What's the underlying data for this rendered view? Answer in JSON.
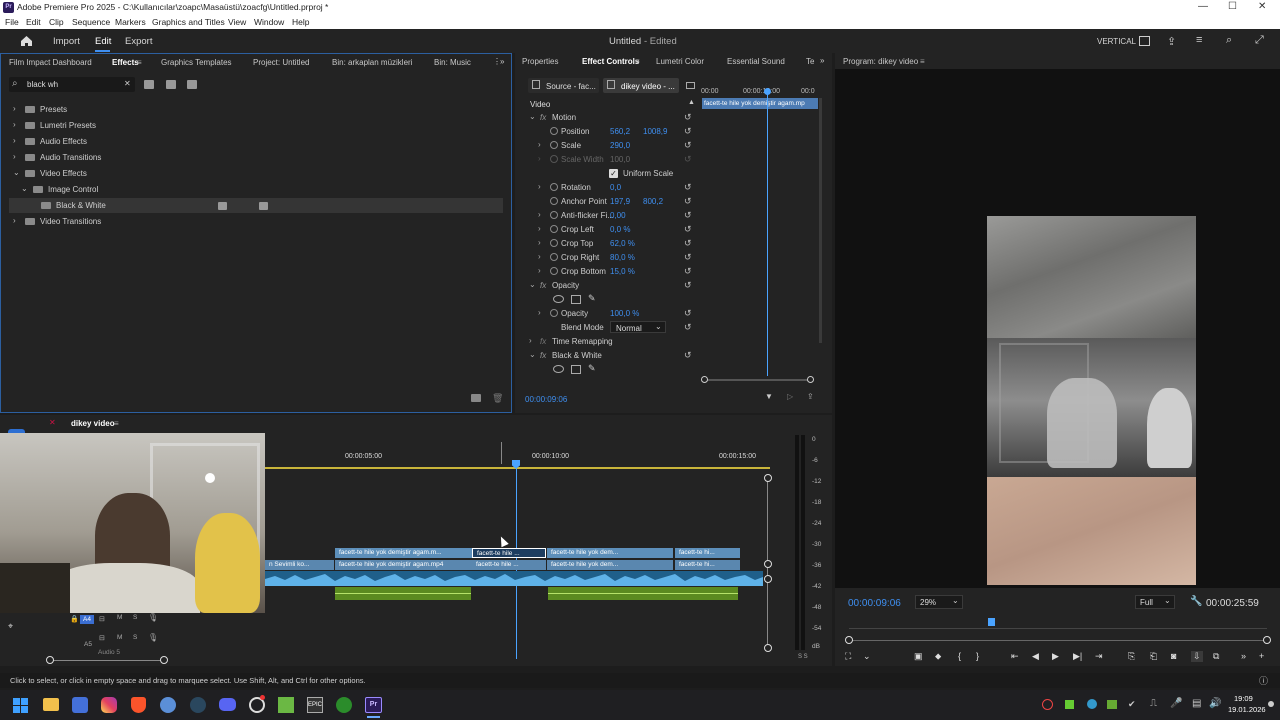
{
  "titlebar": {
    "icon": "Pr",
    "title": "Adobe Premiere Pro 2025 - C:\\Kullanıcılar\\zoapc\\Masaüstü\\zoacfg\\Untitled.prproj *",
    "minimize": "—",
    "maximize": "☐",
    "close": "✕"
  },
  "menu": [
    "File",
    "Edit",
    "Clip",
    "Sequence",
    "Markers",
    "Graphics and Titles",
    "View",
    "Window",
    "Help"
  ],
  "appbar": {
    "home_icon": "home-icon",
    "tabs": [
      "Import",
      "Edit",
      "Export"
    ],
    "project_title": "Untitled",
    "project_status": "- Edited",
    "layout_label": "VERTICAL"
  },
  "left_panel": {
    "tabs": [
      "Film Impact Dashboard",
      "Effects",
      "Graphics Templates",
      "Project: Untitled",
      "Bin: arkaplan müzikleri",
      "Bin: Music"
    ],
    "search_value": "black wh",
    "tree": [
      {
        "label": "Presets",
        "level": 0,
        "expanded": false
      },
      {
        "label": "Lumetri Presets",
        "level": 0,
        "expanded": false
      },
      {
        "label": "Audio Effects",
        "level": 0,
        "expanded": false
      },
      {
        "label": "Audio Transitions",
        "level": 0,
        "expanded": false
      },
      {
        "label": "Video Effects",
        "level": 0,
        "expanded": true
      },
      {
        "label": "Image Control",
        "level": 1,
        "expanded": true
      },
      {
        "label": "Black & White",
        "level": 2,
        "expanded": false
      },
      {
        "label": "Video Transitions",
        "level": 0,
        "expanded": false
      }
    ]
  },
  "effect_controls": {
    "tabs": [
      "Properties",
      "Effect Controls",
      "Lumetri Color",
      "Essential Sound",
      "Te"
    ],
    "source_tab": "Source - fac...",
    "seq_tab": "dikey video - ...",
    "section": "Video",
    "ruler": [
      "00:00",
      "00:00:10:00",
      "00:0"
    ],
    "clip_label": "facett-te hile yok demiştir agam.mp",
    "motion_label": "Motion",
    "params": {
      "position": {
        "name": "Position",
        "v1": "560,2",
        "v2": "1008,9"
      },
      "scale": {
        "name": "Scale",
        "v1": "290,0"
      },
      "scale_width": {
        "name": "Scale Width",
        "v1": "100,0"
      },
      "uniform": "Uniform Scale",
      "rotation": {
        "name": "Rotation",
        "v1": "0,0"
      },
      "anchor": {
        "name": "Anchor Point",
        "v1": "197,9",
        "v2": "800,2"
      },
      "antiflicker": {
        "name": "Anti-flicker Fi...",
        "v1": "0,00"
      },
      "crop_left": {
        "name": "Crop Left",
        "v1": "0,0 %"
      },
      "crop_top": {
        "name": "Crop Top",
        "v1": "62,0 %"
      },
      "crop_right": {
        "name": "Crop Right",
        "v1": "80,0 %"
      },
      "crop_bottom": {
        "name": "Crop Bottom",
        "v1": "15,0 %"
      }
    },
    "opacity_label": "Opacity",
    "opacity_param": {
      "name": "Opacity",
      "v1": "100,0 %"
    },
    "blend_mode": {
      "name": "Blend Mode",
      "value": "Normal"
    },
    "time_remap": "Time Remapping",
    "bw_label": "Black & White",
    "timecode": "00:00:09:06"
  },
  "program": {
    "title": "Program: dikey video",
    "timecode": "00:00:09:06",
    "zoom": "29%",
    "quality": "Full",
    "duration": "00:00:25:59"
  },
  "timeline": {
    "seq_tab": "dikey video",
    "ruler": [
      "00:00:05:00",
      "00:00:10:00",
      "00:00:15:00"
    ],
    "track_a4": "A4",
    "track_a5": "A5",
    "audio_label": "Audio 5",
    "v_clips": [
      "facett-te hile yok demiştir agam.m...",
      "facett-te hile ...",
      "facett-te hile yok dem...",
      "facett-te hi..."
    ],
    "v_clips2": [
      "n Sevimli ko...",
      "facett-te hile yok demiştir agam.mp4",
      "facett-te hile ...",
      "facett-te hile yok dem...",
      "facett-te hi..."
    ],
    "fx": "fx"
  },
  "meter": {
    "labels": [
      "0",
      "-6",
      "-12",
      "-18",
      "-24",
      "-30",
      "-36",
      "-42",
      "-48",
      "-54",
      "dB"
    ],
    "footer": "S S"
  },
  "status": "Click to select, or click in empty space and drag to marquee select. Use Shift, Alt, and Ctrl for other options.",
  "taskbar": {
    "time": "19:09",
    "date": "19.01.2026"
  },
  "colors": {
    "accent": "#3f8ff0",
    "clip_video": "#5d8fba",
    "clip_audio": "#1f5f8a",
    "clip_green": "#5b8a20",
    "playhead": "#4aa3ff"
  }
}
